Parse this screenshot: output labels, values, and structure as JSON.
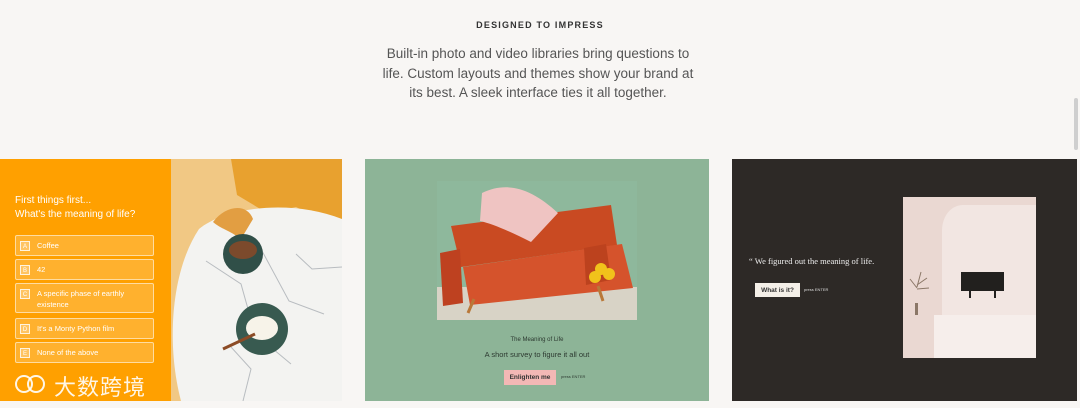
{
  "section": {
    "eyebrow": "DESIGNED TO IMPRESS",
    "intro": "Built-in photo and video libraries bring questions to life. Custom layouts and themes show your brand at its best. A sleek interface ties it all together."
  },
  "cards": [
    {
      "question": "First things first...\nWhat's the meaning of life?",
      "options": [
        {
          "key": "A",
          "label": "Coffee"
        },
        {
          "key": "B",
          "label": "42"
        },
        {
          "key": "C",
          "label": "A specific phase of earthly existence"
        },
        {
          "key": "D",
          "label": "It's a Monty Python film"
        },
        {
          "key": "E",
          "label": "None of the above"
        }
      ],
      "accent": "#ffa000"
    },
    {
      "title": "The Meaning of Life",
      "subtitle": "A short survey to figure it all out",
      "button": "Enlighten me",
      "hint": "press ENTER",
      "accent": "#8db497"
    },
    {
      "quote": "“ We figured out the meaning of life.",
      "button": "What is it?",
      "hint": "press ENTER",
      "accent": "#2d2926"
    }
  ],
  "watermark": "大数跨境"
}
